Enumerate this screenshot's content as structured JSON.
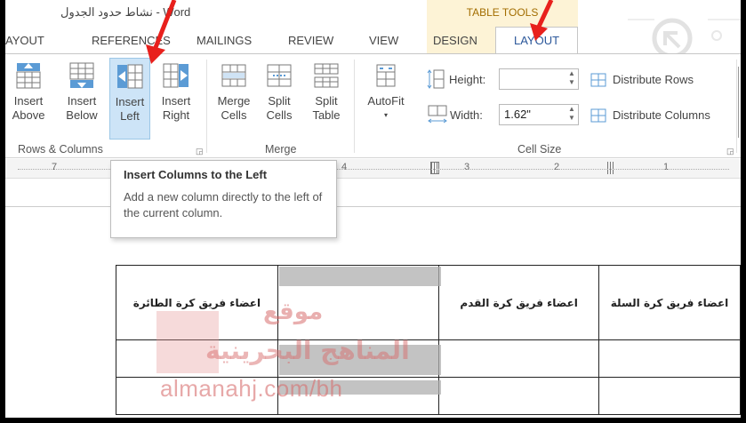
{
  "title_bar": {
    "document_title": "نشاط حدود الجدول - Word",
    "table_tools_label": "TABLE TOOLS"
  },
  "tabs": [
    {
      "label": "AYOUT"
    },
    {
      "label": "REFERENCES"
    },
    {
      "label": "MAILINGS"
    },
    {
      "label": "REVIEW"
    },
    {
      "label": "VIEW"
    },
    {
      "label": "DESIGN"
    },
    {
      "label": "LAYOUT"
    }
  ],
  "ribbon": {
    "rows_columns": {
      "group_label": "Rows & Columns",
      "buttons": [
        {
          "line1": "Insert",
          "line2": "Above"
        },
        {
          "line1": "Insert",
          "line2": "Below"
        },
        {
          "line1": "Insert",
          "line2": "Left"
        },
        {
          "line1": "Insert",
          "line2": "Right"
        }
      ]
    },
    "merge": {
      "group_label": "Merge",
      "buttons": [
        {
          "line1": "Merge",
          "line2": "Cells"
        },
        {
          "line1": "Split",
          "line2": "Cells"
        },
        {
          "line1": "Split",
          "line2": "Table"
        }
      ]
    },
    "cell_size": {
      "group_label": "Cell Size",
      "autofit_label": "AutoFit",
      "height_label": "Height:",
      "height_value": "",
      "width_label": "Width:",
      "width_value": "1.62\"",
      "distribute_rows": "Distribute Rows",
      "distribute_columns": "Distribute Columns"
    }
  },
  "ruler": {
    "numbers": [
      "7",
      "4",
      "3",
      "2",
      "1"
    ]
  },
  "tooltip": {
    "title": "Insert Columns to the Left",
    "description": "Add a new column directly to the left of the current column."
  },
  "table": {
    "headers": [
      "اعضاء فريق كرة الطائرة",
      "",
      "اعضاء فريق كرة القدم",
      "اعضاء فريق كرة السلة"
    ]
  },
  "watermark": {
    "line1": "موقع",
    "line2": "المناهج البحرينية",
    "url": "almanahj.com/bh"
  },
  "colors": {
    "accent_blue": "#2b579a",
    "table_tools_bg": "#fdf3d6",
    "selected_button_bg": "#cde4f7",
    "arrow_red": "#e8201c"
  }
}
